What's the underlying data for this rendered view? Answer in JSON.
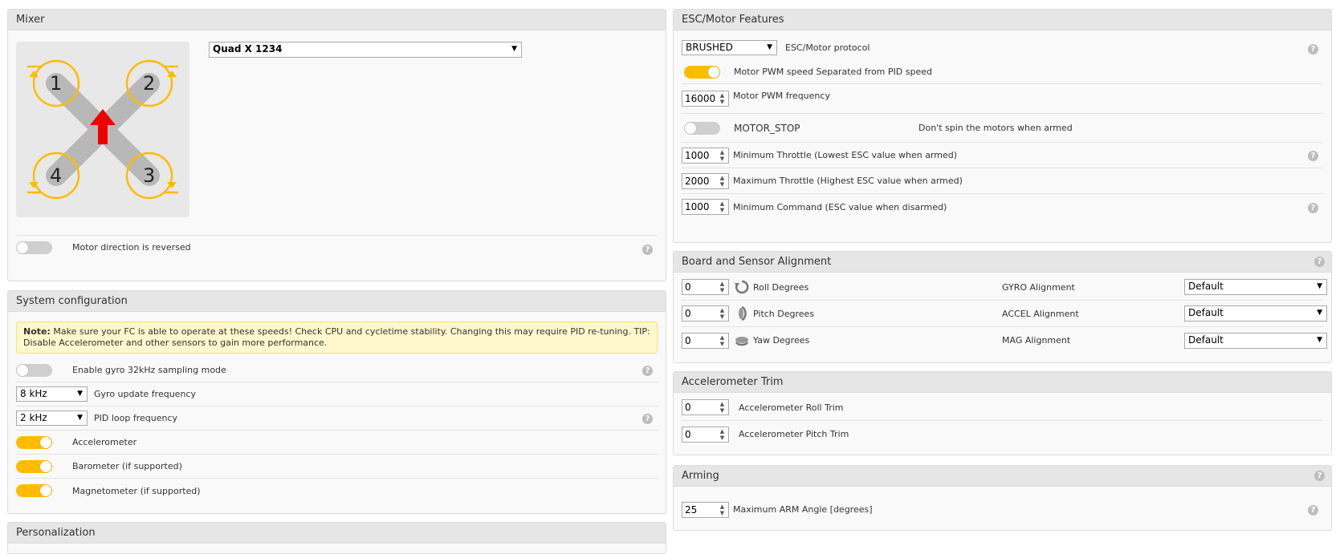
{
  "mixer": {
    "title": "Mixer",
    "type_value": "Quad X 1234",
    "motor_labels": [
      "1",
      "2",
      "4",
      "3"
    ],
    "reversed_label": "Motor direction is reversed",
    "reversed_on": false
  },
  "system": {
    "title": "System configuration",
    "note_bold": "Note:",
    "note_text": " Make sure your FC is able to operate at these speeds! Check CPU and cycletime stability. Changing this may require PID re-tuning. TIP: Disable Accelerometer and other sensors to gain more performance.",
    "gyro32_label": "Enable gyro 32kHz sampling mode",
    "gyro_freq_value": "8 kHz",
    "gyro_freq_label": "Gyro update frequency",
    "pid_freq_value": "2 kHz",
    "pid_freq_label": "PID loop frequency",
    "accel_label": "Accelerometer",
    "baro_label": "Barometer (if supported)",
    "mag_label": "Magnetometer (if supported)"
  },
  "personalization": {
    "title": "Personalization"
  },
  "esc": {
    "title": "ESC/Motor Features",
    "protocol_value": "BRUSHED",
    "protocol_label": "ESC/Motor protocol",
    "pwm_sep_label": "Motor PWM speed Separated from PID speed",
    "pwm_freq_value": "16000",
    "pwm_freq_label": "Motor PWM frequency",
    "motor_stop_label": "MOTOR_STOP",
    "motor_stop_desc": "Don't spin the motors when armed",
    "min_throttle_value": "1000",
    "min_throttle_label": "Minimum Throttle (Lowest ESC value when armed)",
    "max_throttle_value": "2000",
    "max_throttle_label": "Maximum Throttle (Highest ESC value when armed)",
    "min_command_value": "1000",
    "min_command_label": "Minimum Command (ESC value when disarmed)"
  },
  "board": {
    "title": "Board and Sensor Alignment",
    "roll_value": "0",
    "roll_label": "Roll Degrees",
    "pitch_value": "0",
    "pitch_label": "Pitch Degrees",
    "yaw_value": "0",
    "yaw_label": "Yaw Degrees",
    "gyro_align_label": "GYRO Alignment",
    "gyro_align_value": "Default",
    "accel_align_label": "ACCEL Alignment",
    "accel_align_value": "Default",
    "mag_align_label": "MAG Alignment",
    "mag_align_value": "Default"
  },
  "acc_trim": {
    "title": "Accelerometer Trim",
    "roll_value": "0",
    "roll_label": "Accelerometer Roll Trim",
    "pitch_value": "0",
    "pitch_label": "Accelerometer Pitch Trim"
  },
  "arming": {
    "title": "Arming",
    "angle_value": "25",
    "angle_label": "Maximum ARM Angle [degrees]"
  },
  "common": {
    "help_glyph": "?",
    "dropdown_glyph": "▼",
    "spin_up": "▲",
    "spin_down": "▼"
  },
  "colors": {
    "accent": "#ffbb00",
    "arrow": "#ee0000",
    "note_bg": "#fff7cd"
  },
  "icons": {
    "help": "help-icon",
    "roll": "roll-icon",
    "pitch": "pitch-icon",
    "yaw": "yaw-icon"
  }
}
